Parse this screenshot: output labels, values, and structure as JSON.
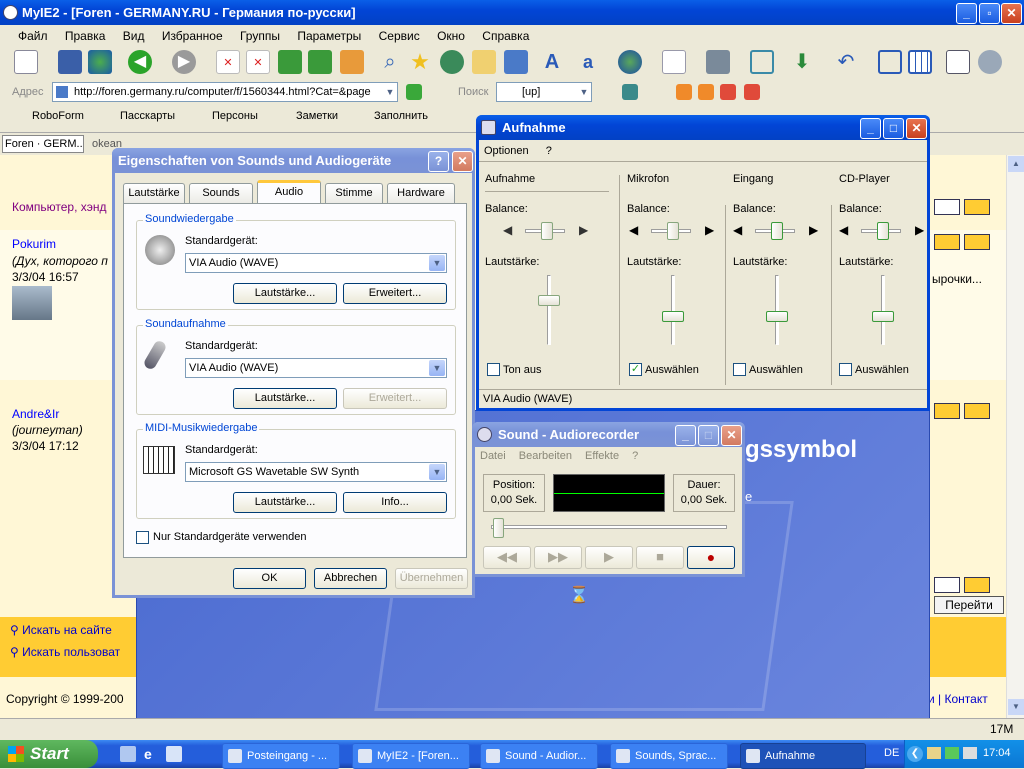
{
  "browser": {
    "title": "MyIE2 - [Foren - GERMANY.RU - Германия по-русски]",
    "menu": [
      "Файл",
      "Правка",
      "Вид",
      "Избранное",
      "Группы",
      "Параметры",
      "Сервис",
      "Окно",
      "Справка"
    ],
    "address_label": "Адрес",
    "address_value": "http://foren.germany.ru/computer/f/1560344.html?Cat=&page",
    "search_label": "Поиск",
    "search_value": "[up]",
    "links": [
      "RoboForm",
      "Пасскарты",
      "Персоны",
      "Заметки",
      "Заполнить"
    ],
    "tabs": [
      "Foren · GERM...",
      "okean"
    ],
    "status_right": "17M"
  },
  "page": {
    "section": "Компьютер, хэнд",
    "user1_name": "Pokurim",
    "user1_note": "(Дух, которого п",
    "user1_date": "3/3/04 16:57",
    "user2_name": "Andre&Ir",
    "user2_note": "(journeyman)",
    "user2_date": "3/3/04 17:12",
    "right_text": "ырочки...",
    "search_site": "Искать на сайте",
    "search_user": "Искать пользоват",
    "go_button": "Перейти",
    "copyright": "Copyright © 1999-200",
    "footer_link_sep": "и",
    "contact": "Контакт",
    "bg_text": "gssymbol",
    "bg_text2": "e"
  },
  "sounds_dialog": {
    "title": "Eigenschaften von Sounds und Audiogeräte",
    "tabs": [
      "Lautstärke",
      "Sounds",
      "Audio",
      "Stimme",
      "Hardware"
    ],
    "playback": {
      "legend": "Soundwiedergabe",
      "label": "Standardgerät:",
      "device": "VIA Audio (WAVE)",
      "btn1": "Lautstärke...",
      "btn2": "Erweitert..."
    },
    "record": {
      "legend": "Soundaufnahme",
      "label": "Standardgerät:",
      "device": "VIA Audio (WAVE)",
      "btn1": "Lautstärke...",
      "btn2": "Erweitert..."
    },
    "midi": {
      "legend": "MIDI-Musikwiedergabe",
      "label": "Standardgerät:",
      "device": "Microsoft GS Wavetable SW Synth",
      "btn1": "Lautstärke...",
      "btn2": "Info..."
    },
    "only_default": "Nur Standardgeräte verwenden",
    "ok": "OK",
    "cancel": "Abbrechen",
    "apply": "Übernehmen"
  },
  "mixer": {
    "title": "Aufnahme",
    "menu": [
      "Optionen",
      "?"
    ],
    "balance_label": "Balance:",
    "volume_label": "Lautstärke:",
    "channels": [
      {
        "name": "Aufnahme",
        "check": "Ton aus",
        "checked": false
      },
      {
        "name": "Mikrofon",
        "check": "Auswählen",
        "checked": true
      },
      {
        "name": "Eingang",
        "check": "Auswählen",
        "checked": false
      },
      {
        "name": "CD-Player",
        "check": "Auswählen",
        "checked": false
      }
    ],
    "status": "VIA Audio (WAVE)"
  },
  "recorder": {
    "title": "Sound - Audiorecorder",
    "menu": [
      "Datei",
      "Bearbeiten",
      "Effekte",
      "?"
    ],
    "position_label": "Position:",
    "position_value": "0,00 Sek.",
    "length_label": "Dauer:",
    "length_value": "0,00 Sek."
  },
  "taskbar": {
    "start": "Start",
    "items": [
      "Posteingang - ...",
      "MyIE2 - [Foren...",
      "Sound - Audior...",
      "Sounds, Sprac...",
      "Aufnahme"
    ],
    "lang": "DE",
    "time": "17:04"
  }
}
